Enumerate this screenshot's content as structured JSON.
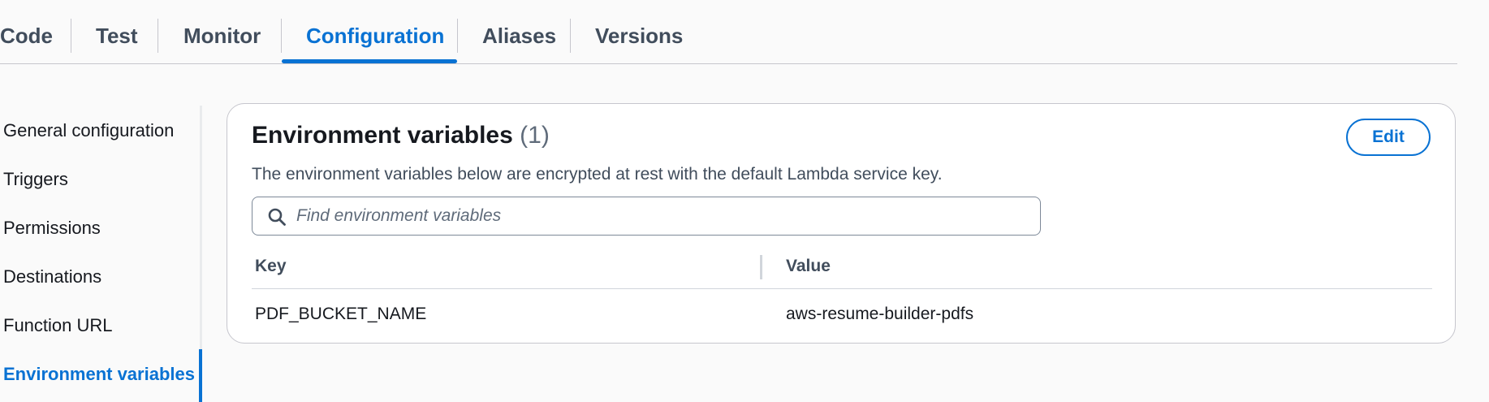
{
  "tabs": [
    {
      "label": "Code"
    },
    {
      "label": "Test"
    },
    {
      "label": "Monitor"
    },
    {
      "label": "Configuration"
    },
    {
      "label": "Aliases"
    },
    {
      "label": "Versions"
    }
  ],
  "active_tab": "Configuration",
  "sidebar": {
    "items": [
      {
        "label": "General configuration"
      },
      {
        "label": "Triggers"
      },
      {
        "label": "Permissions"
      },
      {
        "label": "Destinations"
      },
      {
        "label": "Function URL"
      },
      {
        "label": "Environment variables"
      }
    ],
    "active_item": "Environment variables"
  },
  "panel": {
    "title": "Environment variables",
    "count": "(1)",
    "description": "The environment variables below are encrypted at rest with the default Lambda service key.",
    "edit_label": "Edit",
    "search_placeholder": "Find environment variables",
    "search_value": "",
    "columns": [
      "Key",
      "Value"
    ],
    "rows": [
      {
        "key": "PDF_BUCKET_NAME",
        "value": "aws-resume-builder-pdfs"
      }
    ]
  },
  "colors": {
    "accent": "#0972d3",
    "text": "#16191f",
    "secondary_text": "#414d5c",
    "background": "#fafafa"
  },
  "icons": {
    "search": "search-icon"
  }
}
